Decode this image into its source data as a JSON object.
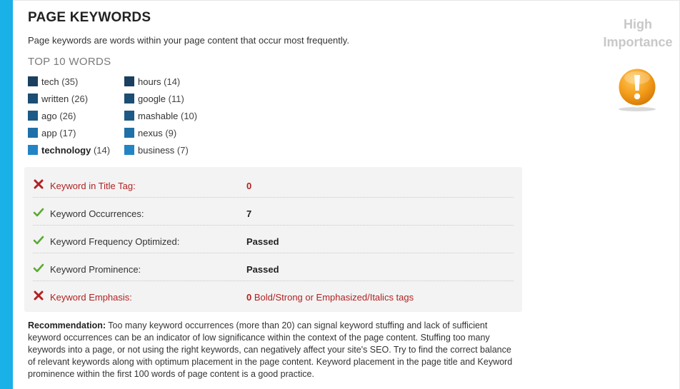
{
  "section": {
    "title": "PAGE KEYWORDS",
    "description": "Page keywords are words within your page content that occur most frequently.",
    "subheading": "TOP 10 WORDS"
  },
  "importance": {
    "line1": "High",
    "line2": "Importance",
    "icon": "warning-exclamation-icon",
    "icon_color": "#f39c1a"
  },
  "top_words": [
    {
      "word": "tech",
      "count": "(35)",
      "color": "#1b3f5e",
      "bold": false
    },
    {
      "word": "written",
      "count": "(26)",
      "color": "#1c4d72",
      "bold": false
    },
    {
      "word": "ago",
      "count": "(26)",
      "color": "#1d5a86",
      "bold": false
    },
    {
      "word": "app",
      "count": "(17)",
      "color": "#1f70a8",
      "bold": false
    },
    {
      "word": "technology",
      "count": "(14)",
      "color": "#2284c4",
      "bold": true
    },
    {
      "word": "hours",
      "count": "(14)",
      "color": "#1b3f5e",
      "bold": false
    },
    {
      "word": "google",
      "count": "(11)",
      "color": "#1c4d72",
      "bold": false
    },
    {
      "word": "mashable",
      "count": "(10)",
      "color": "#1d5a86",
      "bold": false
    },
    {
      "word": "nexus",
      "count": "(9)",
      "color": "#1f70a8",
      "bold": false
    },
    {
      "word": "business",
      "count": "(7)",
      "color": "#2284c4",
      "bold": false
    }
  ],
  "checks": [
    {
      "status": "fail",
      "icon": "cross-icon",
      "label": "Keyword in Title Tag:",
      "value": "0",
      "note": ""
    },
    {
      "status": "pass",
      "icon": "check-icon",
      "label": "Keyword Occurrences:",
      "value": "7",
      "note": ""
    },
    {
      "status": "pass",
      "icon": "check-icon",
      "label": "Keyword Frequency Optimized:",
      "value": "Passed",
      "note": ""
    },
    {
      "status": "pass",
      "icon": "check-icon",
      "label": "Keyword Prominence:",
      "value": "Passed",
      "note": ""
    },
    {
      "status": "fail",
      "icon": "cross-icon",
      "label": "Keyword Emphasis:",
      "value": "0",
      "note": " Bold/Strong or Emphasized/Italics tags"
    }
  ],
  "recommendation": {
    "label": "Recommendation:",
    "text": " Too many keyword occurrences (more than 20) can signal keyword stuffing and lack of sufficient keyword occurrences can be an indicator of low significance within the context of the page content. Stuffing too many keywords into a page, or not using the right keywords, can negatively affect your site's SEO. Try to find the correct balance of relevant keywords along with optimum placement in the page content. Keyword placement in the page title and Keyword prominence within the first 100 words of page content is a good practice."
  },
  "colors": {
    "accent_bar": "#1ab0e8",
    "fail": "#b22222",
    "pass": "#5aa832"
  }
}
